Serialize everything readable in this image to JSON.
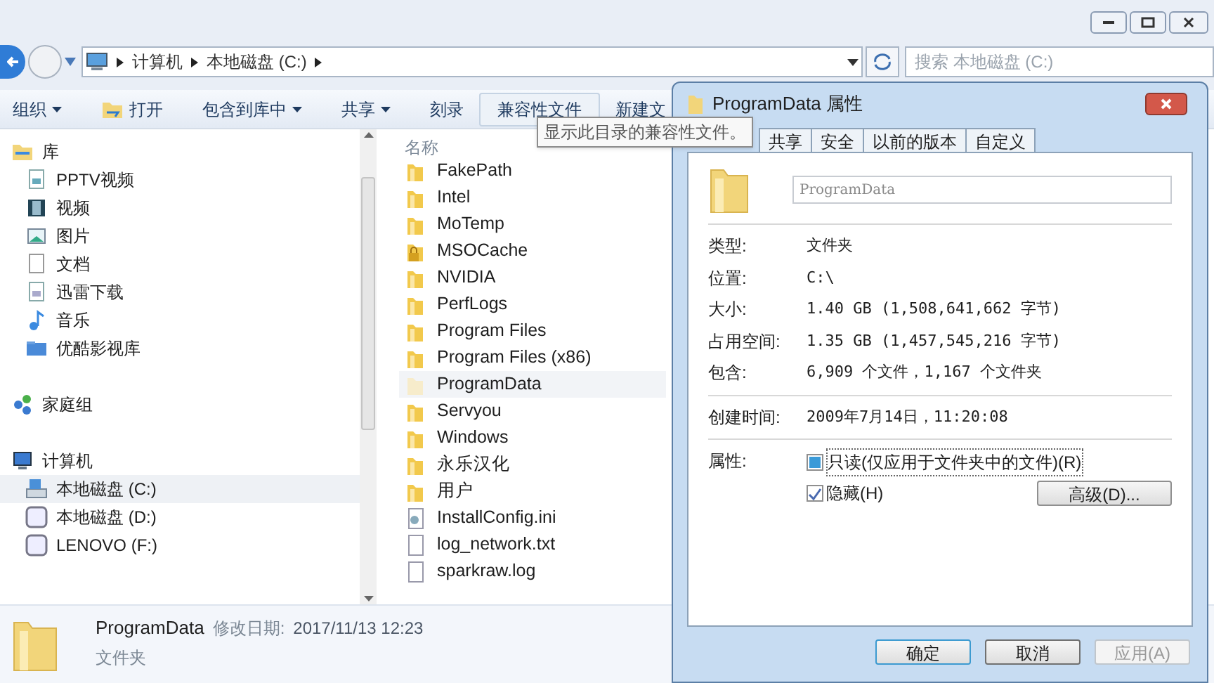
{
  "address": {
    "crumbs": [
      "计算机",
      "本地磁盘 (C:)"
    ],
    "search_placeholder": "搜索 本地磁盘 (C:)"
  },
  "toolbar": [
    {
      "label": "组织",
      "kind": "menu",
      "hovered": false
    },
    {
      "label": "打开",
      "kind": "icon",
      "hovered": false
    },
    {
      "label": "包含到库中",
      "kind": "menu",
      "hovered": false
    },
    {
      "label": "共享",
      "kind": "menu",
      "hovered": false
    },
    {
      "label": "刻录",
      "kind": "plain",
      "hovered": false
    },
    {
      "label": "兼容性文件",
      "kind": "plain",
      "hovered": true
    },
    {
      "label": "新建文",
      "kind": "plain",
      "hovered": false
    }
  ],
  "tooltip": "显示此目录的兼容性文件。",
  "sidebar": [
    {
      "label": "库",
      "children": [
        {
          "label": "PPTV视频",
          "selected": false
        },
        {
          "label": "视频",
          "selected": false
        },
        {
          "label": "图片",
          "selected": false
        },
        {
          "label": "文档",
          "selected": false
        },
        {
          "label": "迅雷下载",
          "selected": false
        },
        {
          "label": "音乐",
          "selected": false
        },
        {
          "label": "优酷影视库",
          "selected": false
        }
      ]
    },
    {
      "label": "家庭组"
    },
    {
      "label": "计算机",
      "children": [
        {
          "label": "本地磁盘 (C:)",
          "selected": true
        },
        {
          "label": "本地磁盘 (D:)",
          "selected": false
        },
        {
          "label": "LENOVO (F:)",
          "selected": false
        }
      ]
    }
  ],
  "files": {
    "column": "名称",
    "items": [
      {
        "name": "FakePath",
        "kind": "folder",
        "selected": false
      },
      {
        "name": "Intel",
        "kind": "folder",
        "selected": false
      },
      {
        "name": "MoTemp",
        "kind": "folder",
        "selected": false
      },
      {
        "name": "MSOCache",
        "kind": "locked",
        "selected": false
      },
      {
        "name": "NVIDIA",
        "kind": "folder",
        "selected": false
      },
      {
        "name": "PerfLogs",
        "kind": "folder",
        "selected": false
      },
      {
        "name": "Program Files",
        "kind": "folder",
        "selected": false
      },
      {
        "name": "Program Files (x86)",
        "kind": "folder",
        "selected": false
      },
      {
        "name": "ProgramData",
        "kind": "hidden",
        "selected": true
      },
      {
        "name": "Servyou",
        "kind": "folder",
        "selected": false
      },
      {
        "name": "Windows",
        "kind": "folder",
        "selected": false
      },
      {
        "name": "永乐汉化",
        "kind": "folder",
        "selected": false
      },
      {
        "name": "用户",
        "kind": "folder",
        "selected": false
      },
      {
        "name": "InstallConfig.ini",
        "kind": "config",
        "selected": false
      },
      {
        "name": "log_network.txt",
        "kind": "file",
        "selected": false
      },
      {
        "name": "sparkraw.log",
        "kind": "file",
        "selected": false
      }
    ]
  },
  "details": {
    "name": "ProgramData",
    "date_label": "修改日期:",
    "date": "2017/11/13 12:23",
    "type": "文件夹"
  },
  "dialog": {
    "title": "ProgramData 属性",
    "tabs": [
      {
        "label": "共享",
        "selected": false
      },
      {
        "label": "安全",
        "selected": false
      },
      {
        "label": "以前的版本",
        "selected": false
      },
      {
        "label": "自定义",
        "selected": false
      }
    ],
    "name_value": "ProgramData",
    "groups": [
      [
        {
          "label": "类型:",
          "value": "文件夹"
        },
        {
          "label": "位置:",
          "value": "C:\\"
        },
        {
          "label": "大小:",
          "value": "1.40 GB (1,508,641,662 字节)"
        },
        {
          "label": "占用空间:",
          "value": "1.35 GB (1,457,545,216 字节)"
        },
        {
          "label": "包含:",
          "value": "6,909 个文件，1,167 个文件夹"
        }
      ],
      [
        {
          "label": "创建时间:",
          "value": "2009年7月14日，11:20:08"
        }
      ]
    ],
    "attributes_label": "属性:",
    "attributes": [
      {
        "label": "只读(仅应用于文件夹中的文件)(R)",
        "checked": false,
        "indeterminate": true
      },
      {
        "label": "隐藏(H)",
        "checked": true,
        "indeterminate": false
      }
    ],
    "advanced": "高级(D)...",
    "buttons": [
      {
        "label": "确定",
        "default": true,
        "disabled": false
      },
      {
        "label": "取消",
        "default": false,
        "disabled": false
      },
      {
        "label": "应用(A)",
        "default": false,
        "disabled": true
      }
    ]
  }
}
